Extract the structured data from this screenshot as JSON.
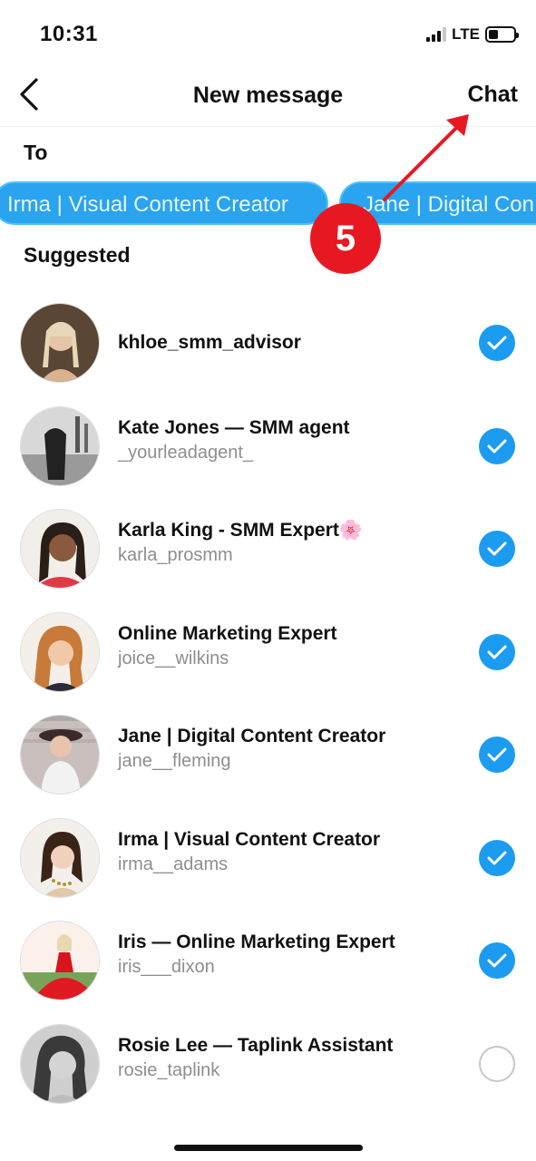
{
  "status_bar": {
    "time": "10:31",
    "network": "LTE"
  },
  "nav": {
    "back_icon": "chevron-left-icon",
    "title": "New message",
    "chat_label": "Chat"
  },
  "to_label": "To",
  "selected_chips": [
    {
      "label": "Irma | Visual Content Creator"
    },
    {
      "label": "Jane | Digital Con"
    }
  ],
  "suggested_label": "Suggested",
  "contacts": [
    {
      "name": "khloe_smm_advisor",
      "handle": "",
      "selected": true
    },
    {
      "name": "Kate Jones — SMM agent",
      "handle": "_yourleadagent_",
      "selected": true
    },
    {
      "name": "Karla King - SMM Expert🌸",
      "handle": "karla_prosmm",
      "selected": true
    },
    {
      "name": "Online Marketing Expert",
      "handle": "joice__wilkins",
      "selected": true
    },
    {
      "name": "Jane | Digital Content Creator",
      "handle": "jane__fleming",
      "selected": true
    },
    {
      "name": "Irma | Visual Content Creator",
      "handle": "irma__adams",
      "selected": true
    },
    {
      "name": "Iris — Online Marketing Expert",
      "handle": "iris___dixon",
      "selected": true
    },
    {
      "name": "Rosie Lee — Taplink Assistant",
      "handle": "rosie_taplink",
      "selected": false
    }
  ],
  "annotation": {
    "step_number": "5",
    "color": "#e81822"
  },
  "colors": {
    "accent": "#1c9cf0",
    "chip_bg": "#2aa4ee"
  }
}
